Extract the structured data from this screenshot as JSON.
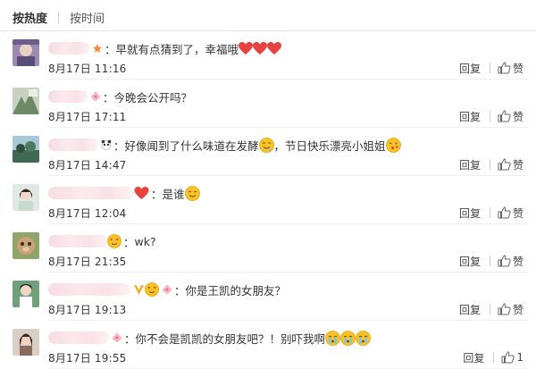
{
  "tabs": [
    {
      "label": "按热度",
      "active": true
    },
    {
      "label": "按时间",
      "active": false
    }
  ],
  "like_label": "赞",
  "reply_label": "回复",
  "comments": [
    {
      "text": "早就有点猜到了，幸福哦",
      "time": "8月17日 11:16",
      "like_count": "",
      "emojis": [
        "heart",
        "heart",
        "heart"
      ],
      "emoji_after": []
    },
    {
      "text": "今晚会公开吗？",
      "time": "8月17日 17:11",
      "like_count": "",
      "emojis": [],
      "emoji_after": []
    },
    {
      "text": "好像闻到了什么味道在发酵",
      "text2": "，节日快乐漂亮小姐姐",
      "time": "8月17日 14:47",
      "like_count": "",
      "emojis": [
        "drool"
      ],
      "emoji_after": [
        "kiss"
      ]
    },
    {
      "text": "是谁",
      "time": "8月17日 12:04",
      "like_count": "",
      "emojis": [
        "smile"
      ],
      "emoji_after": []
    },
    {
      "text": "wk?",
      "time": "8月17日 21:35",
      "like_count": "",
      "emojis": [],
      "emoji_after": []
    },
    {
      "text": "你是王凯的女朋友？",
      "time": "8月17日 19:13",
      "like_count": "",
      "emojis": [],
      "emoji_after": []
    },
    {
      "text": "你不会是凯凯的女朋友吧？！别吓我啊",
      "time": "8月17日 19:55",
      "like_count": "1",
      "emojis": [
        "cry",
        "cry",
        "cry"
      ],
      "emoji_after": []
    }
  ],
  "colors": {
    "text": "#333333",
    "time": "#333333",
    "heart": "#e8423f",
    "emoji_yellow": "#f7c325"
  }
}
